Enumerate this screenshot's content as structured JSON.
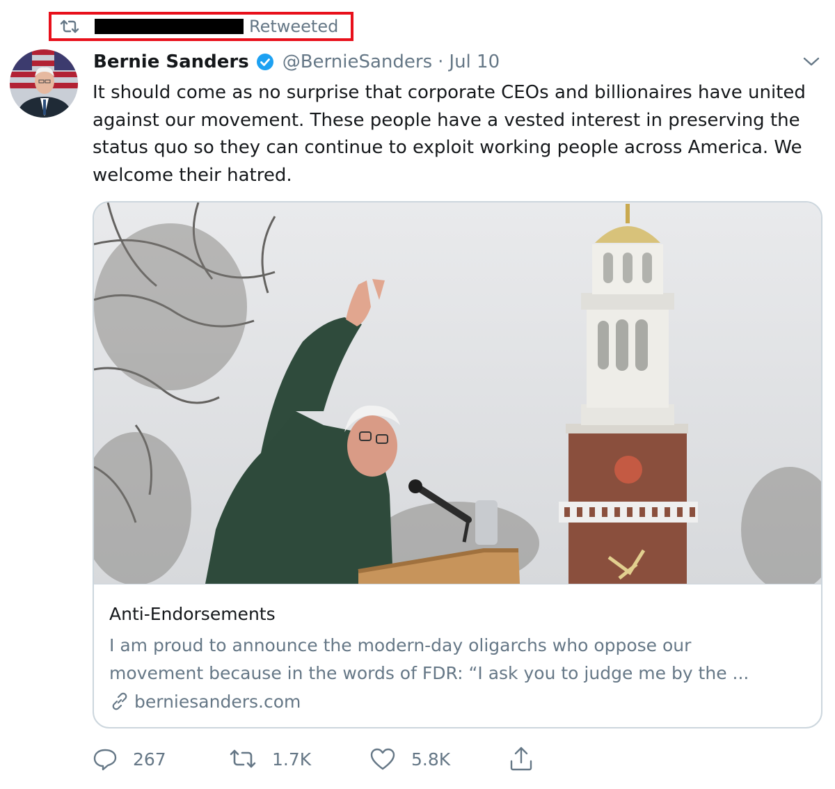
{
  "retweet_banner": {
    "label": "Retweeted"
  },
  "author": {
    "name": "Bernie Sanders",
    "handle": "@BernieSanders",
    "separator": "·",
    "date": "Jul 10"
  },
  "tweet": {
    "text": "It should come as no surprise that corporate CEOs and billionaires have united\nagainst our movement. These people have a vested interest in preserving the\nstatus quo so they can continue to exploit working people across America. We\nwelcome their hatred."
  },
  "card": {
    "title": "Anti-Endorsements",
    "description": "I am proud to announce the modern-day oligarchs who oppose our\nmovement because in the words of FDR: “I ask you to judge me by the ...",
    "domain": "berniesanders.com"
  },
  "actions": {
    "replies": "267",
    "retweets": "1.7K",
    "likes": "5.8K"
  },
  "icons": {
    "retweet": "retweet-icon",
    "verified": "verified-badge-icon",
    "chevron": "chevron-down-icon",
    "link": "link-icon",
    "reply": "reply-icon",
    "like": "heart-icon",
    "share": "share-icon"
  },
  "colors": {
    "highlight_box": "#e8101b",
    "verified": "#1da1f2",
    "secondary_text": "#657786",
    "border": "#ccd6dd"
  }
}
